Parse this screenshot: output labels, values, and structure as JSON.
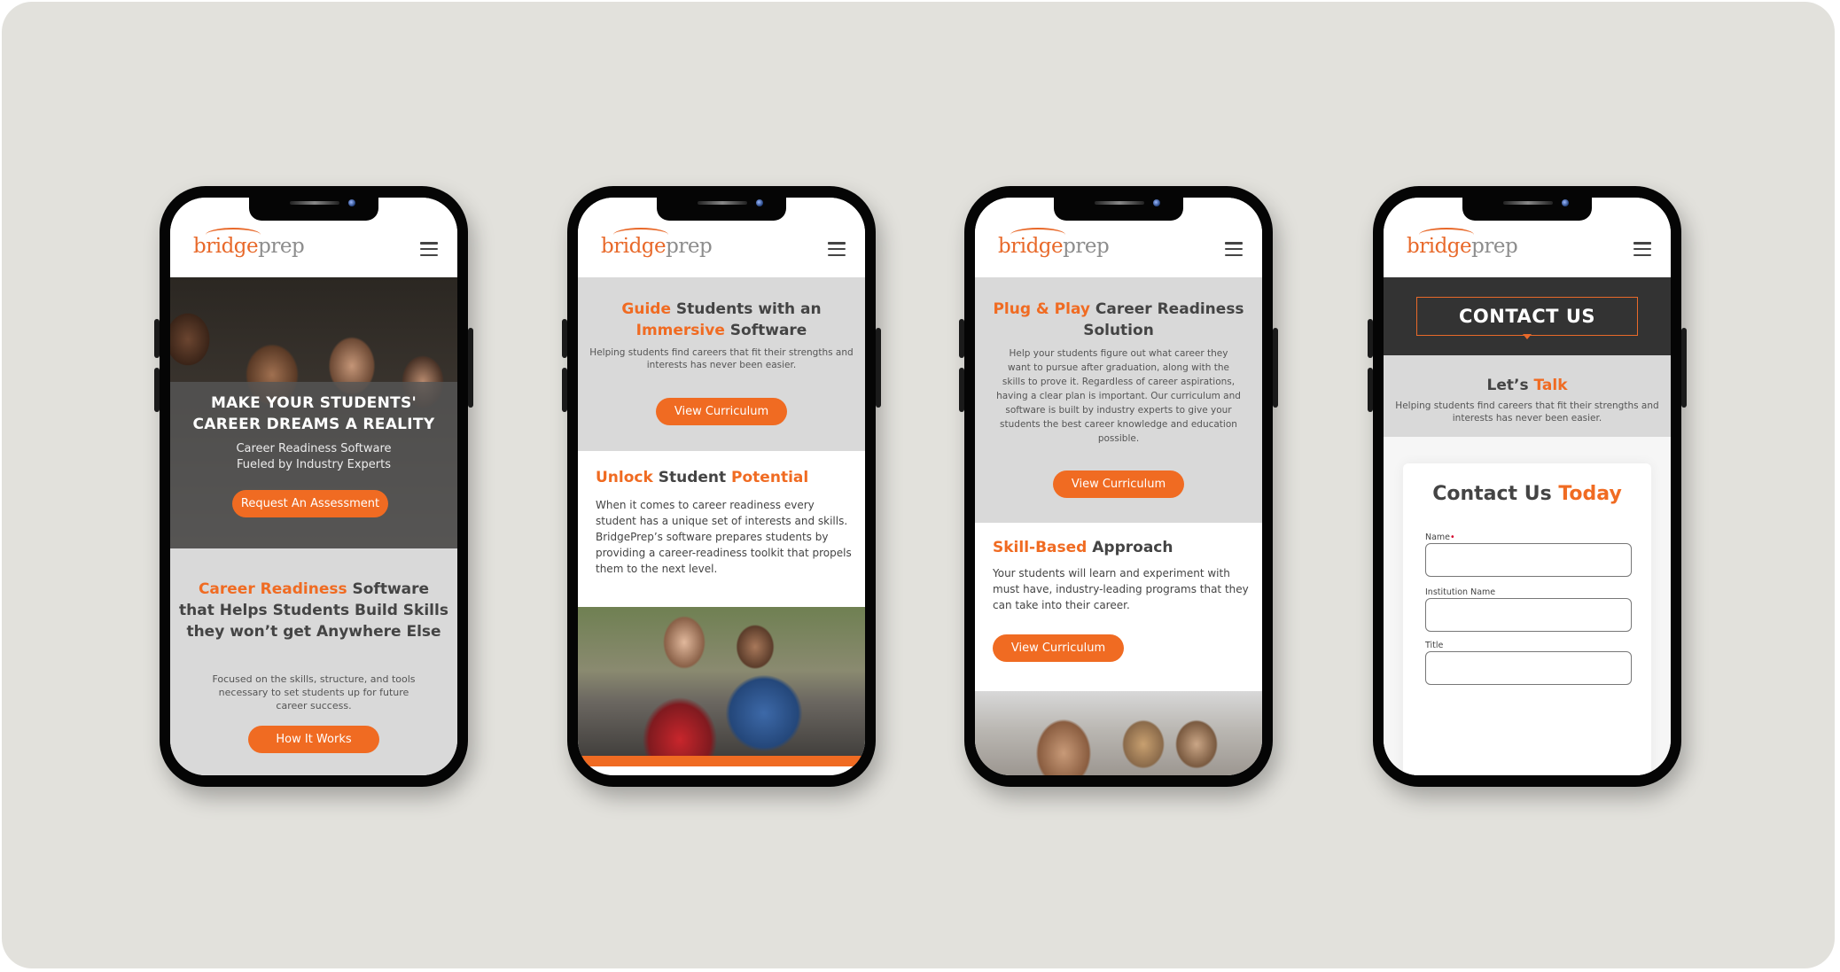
{
  "brand": {
    "logo_part1": "bridge",
    "logo_part2": "prep",
    "orange": "#f06b22",
    "dark_text": "#444444",
    "section_gray": "#d9d9d9",
    "background": "#e2e1dc"
  },
  "phones": [
    {
      "hero": {
        "title_line1": "MAKE YOUR STUDENTS'",
        "title_line2": "CAREER DREAMS A REALITY",
        "subtitle_line1": "Career Readiness Software",
        "subtitle_line2": "Fueled by Industry Experts",
        "button": "Request An Assessment"
      },
      "section": {
        "title_accent": "Career Readiness",
        "title_rest": " Software that Helps Students Build Skills they won’t get Anywhere Else",
        "paragraph": "Focused on the skills, structure, and tools necessary to set students up for future career success.",
        "button": "How It Works"
      }
    },
    {
      "section_a": {
        "title_accent1": "Guide",
        "title_mid": " Students with an ",
        "title_accent2": "Immersive",
        "title_end": " Software",
        "paragraph": "Helping students find careers that fit their strengths and interests has never been easier.",
        "button": "View Curriculum"
      },
      "section_b": {
        "title_accent1": "Unlock",
        "title_mid": " Student ",
        "title_accent2": "Potential",
        "paragraph": "When it comes to career readiness every student has a unique set of interests and skills. BridgePrep’s software prepares students by providing a career-readiness toolkit that propels them to the next level."
      }
    },
    {
      "section_a": {
        "title_accent": "Plug & Play",
        "title_rest": " Career Readiness Solution",
        "paragraph": "Help your students figure out what career they want to pursue after graduation, along with the skills to prove it. Regardless of career aspirations, having a clear plan is important. Our curriculum and software is built by industry experts to give your students the best career knowledge and education possible.",
        "button": "View Curriculum"
      },
      "section_b": {
        "title_accent": "Skill-Based",
        "title_rest": " Approach",
        "paragraph": "Your students will learn and experiment with must have, industry-leading programs that they can take into their career.",
        "button": "View Curriculum"
      }
    },
    {
      "banner": {
        "title": "CONTACT US"
      },
      "intro": {
        "title_dark": "Let’s ",
        "title_accent": "Talk",
        "paragraph": "Helping students find careers that fit their strengths and interests has never been easier."
      },
      "form": {
        "title_dark": "Contact Us ",
        "title_accent": "Today",
        "fields": [
          {
            "label": "Name",
            "required": "•",
            "value": ""
          },
          {
            "label": "Institution Name",
            "value": ""
          },
          {
            "label": "Title",
            "value": ""
          }
        ]
      }
    }
  ]
}
